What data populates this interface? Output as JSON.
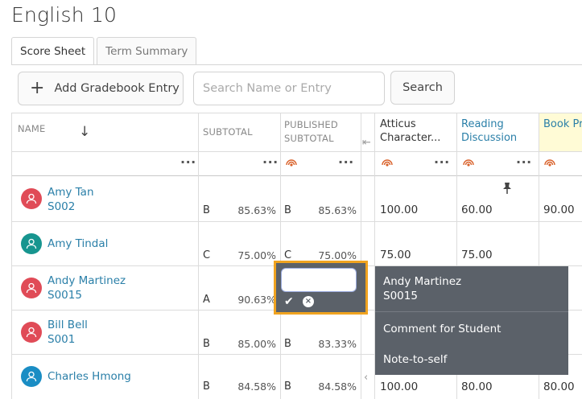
{
  "page": {
    "title": "English 10"
  },
  "tabs": [
    {
      "label": "Score Sheet",
      "active": true
    },
    {
      "label": "Term Summary",
      "active": false
    }
  ],
  "toolbar": {
    "add_label": "Add Gradebook Entry",
    "search_placeholder": "Search Name or Entry",
    "search_button": "Search"
  },
  "columns": {
    "name": "NAME",
    "subtotal": "SUBTOTAL",
    "published_line1": "PUBLISHED",
    "published_line2": "SUBTOTAL",
    "c1_line1": "Atticus",
    "c1_line2": "Character...",
    "c2_line1": "Reading",
    "c2_line2": "Discussion",
    "c3_line1": "Book Pro"
  },
  "colors": {
    "accent_link": "#2a7fa8",
    "highlight": "#f0a320",
    "avatar_red": "#e04b57",
    "avatar_teal": "#17958f",
    "avatar_blue": "#1a8dc4"
  },
  "students": [
    {
      "name": "Amy Tan",
      "id": "S002",
      "sub_grade": "B",
      "sub_pct": "85.63%",
      "pub_grade": "B",
      "pub_pct": "85.63%",
      "c1": "100.00",
      "c2": "60.00",
      "c3": "90.00"
    },
    {
      "name": "Amy Tindal",
      "id": "",
      "sub_grade": "C",
      "sub_pct": "75.00%",
      "pub_grade": "C",
      "pub_pct": "75.00%",
      "c1": "75.00",
      "c2": "75.00",
      "c3": ""
    },
    {
      "name": "Andy Martinez",
      "id": "S0015",
      "sub_grade": "A",
      "sub_pct": "90.63%",
      "pub_grade": "",
      "pub_pct": "",
      "c1": "",
      "c2": "",
      "c3": ""
    },
    {
      "name": "Bill Bell",
      "id": "S001",
      "sub_grade": "B",
      "sub_pct": "85.00%",
      "pub_grade": "B",
      "pub_pct": "83.33%",
      "c1": "",
      "c2": "",
      "c3": ""
    },
    {
      "name": "Charles Hmong",
      "id": "",
      "sub_grade": "B",
      "sub_pct": "84.58%",
      "pub_grade": "B",
      "pub_pct": "84.58%",
      "c1": "100.00",
      "c2": "80.00",
      "c3": "80.00"
    }
  ],
  "popup": {
    "student_name": "Andy Martinez",
    "student_id": "S0015",
    "items": [
      "Comment for Student",
      "Note-to-self"
    ]
  }
}
